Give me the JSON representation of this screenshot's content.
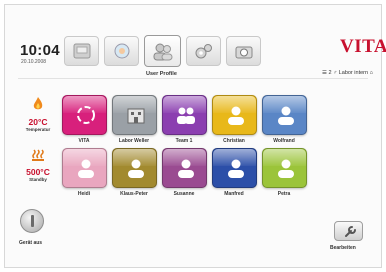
{
  "header": {
    "time": "10:04",
    "date": "20.10.2008",
    "logo": "VITA",
    "status": "☰ 2 ♂ Labor intern ⌂",
    "active_tab_label": "User Profile"
  },
  "tabs": [
    {
      "icon": "furnace-icon"
    },
    {
      "icon": "cooling-icon"
    },
    {
      "icon": "user-profile-icon"
    },
    {
      "icon": "settings-gears-icon"
    },
    {
      "icon": "camera-icon"
    }
  ],
  "left": {
    "temp1": {
      "value": "20°C",
      "label": "Temperatur",
      "icon": "flame-icon"
    },
    "temp2": {
      "value": "500°C",
      "label": "Standby",
      "icon": "heat-waves-icon"
    },
    "power_label": "Gerät aus"
  },
  "profiles": [
    {
      "name": "VITA",
      "color": "#d8207c"
    },
    {
      "name": "Labor Weller",
      "color": "#9aa0a6"
    },
    {
      "name": "Team 1",
      "color": "#8b3fb0"
    },
    {
      "name": "Christian",
      "color": "#e8b81a"
    },
    {
      "name": "Wolfrand",
      "color": "#5a86c6"
    },
    {
      "name": "Heidi",
      "color": "#e9a6bf"
    },
    {
      "name": "Klaus-Peter",
      "color": "#a28a2f"
    },
    {
      "name": "Susanne",
      "color": "#9a4b91"
    },
    {
      "name": "Manfred",
      "color": "#2c4fa8"
    },
    {
      "name": "Petra",
      "color": "#9bc43a"
    }
  ],
  "edit_label": "Bearbeiten"
}
